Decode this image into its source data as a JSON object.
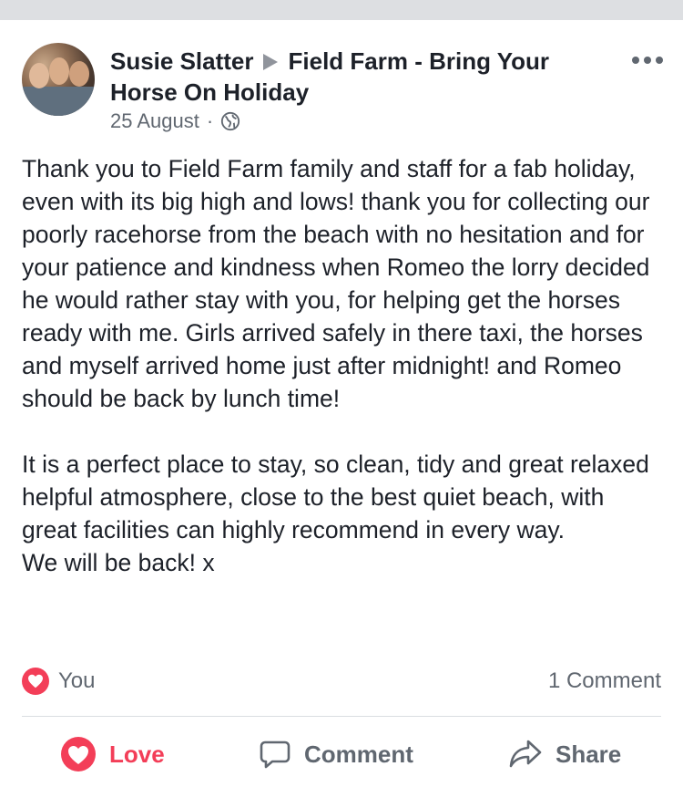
{
  "post": {
    "author": "Susie Slatter",
    "target_page": "Field Farm - Bring Your Horse On Holiday",
    "date": "25 August",
    "separator": "·",
    "privacy_icon": "globe-icon",
    "more_icon": "more-options-icon",
    "body": "Thank you to Field Farm family and staff for a fab holiday, even with its big high and lows! thank you for collecting our poorly racehorse from the beach with no hesitation and for your patience and kindness when Romeo the lorry decided he would rather stay with you, for helping get the horses ready with me. Girls arrived safely in there taxi, the horses and myself arrived home just after midnight! and Romeo should be back by lunch time!\n\nIt is a perfect place to stay, so clean, tidy and great relaxed helpful atmosphere, close to the best quiet beach, with great facilities can highly recommend in every way.\nWe will be back! x"
  },
  "reactions": {
    "label": "You",
    "icon": "heart-icon",
    "comment_count": "1 Comment"
  },
  "actions": {
    "love_label": "Love",
    "comment_label": "Comment",
    "share_label": "Share"
  },
  "colors": {
    "love": "#f33e58",
    "secondary_text": "#606770",
    "primary_text": "#1d2129"
  }
}
